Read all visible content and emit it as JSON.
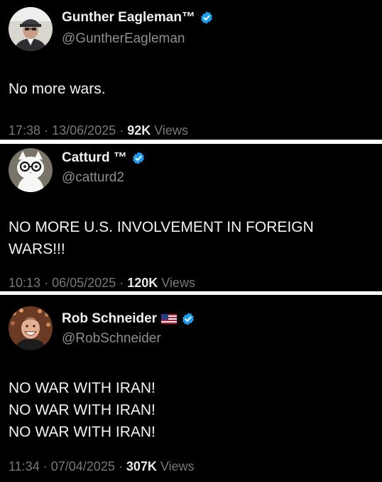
{
  "tweets": [
    {
      "display_name": "Gunther Eagleman™",
      "handle": "@GuntherEagleman",
      "body_lines": [
        "No more wars."
      ],
      "time": "17:38",
      "date": "13/06/2025",
      "views_count": "92K",
      "views_label": "Views",
      "avatar_icon": "man-with-cap-avatar"
    },
    {
      "display_name": "Catturd ™",
      "handle": "@catturd2",
      "body_lines": [
        "NO MORE U.S. INVOLVEMENT IN FOREIGN",
        "WARS!!!"
      ],
      "time": "10:13",
      "date": "06/05/2025",
      "views_count": "120K",
      "views_label": "Views",
      "avatar_icon": "cat-with-glasses-avatar"
    },
    {
      "display_name": "Rob Schneider",
      "handle": "@RobSchneider",
      "body_lines": [
        "NO WAR WITH IRAN!",
        "NO WAR WITH IRAN!",
        "NO WAR WITH IRAN!"
      ],
      "time": "11:34",
      "date": "07/04/2025",
      "views_count": "307K",
      "views_label": "Views",
      "avatar_icon": "smiling-man-crowd-avatar",
      "flag_icon": "us-flag-icon"
    }
  ],
  "colors": {
    "background": "#000000",
    "verified_badge": "#1d9bf0",
    "secondary_text": "#74787d",
    "separator": "#ffffff"
  },
  "meta_separator": "·"
}
